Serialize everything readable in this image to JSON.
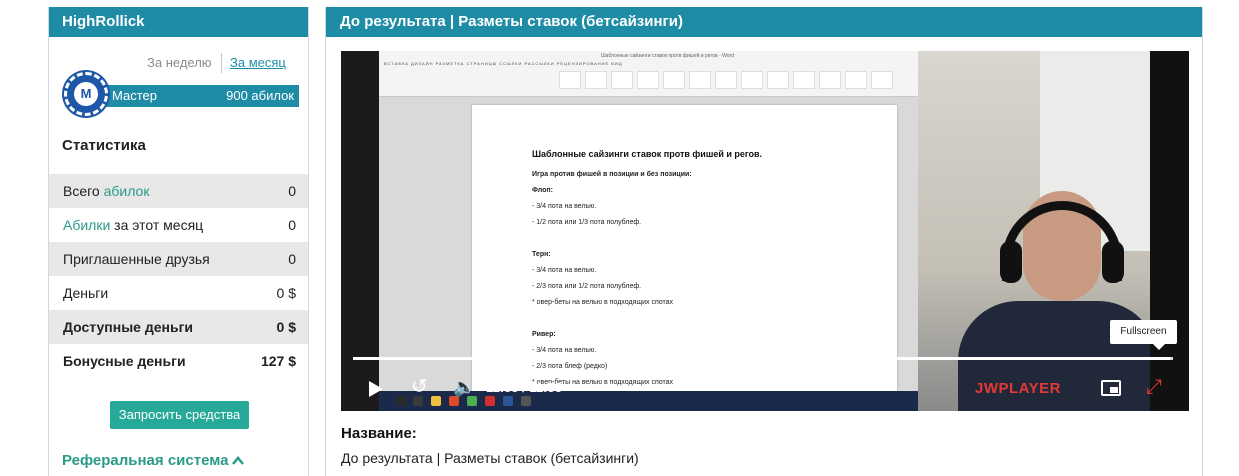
{
  "left_panel": {
    "header": "HighRollick",
    "tab_week": "За неделю",
    "tab_month": "За месяц",
    "level_badge_letter": "М",
    "level_name": "Мастер",
    "level_points": "900 абилок",
    "stats_title": "Статистика",
    "stats": [
      {
        "label_pre": "Всего ",
        "label_link": "абилок",
        "label_post": "",
        "value": "0"
      },
      {
        "label_pre": "",
        "label_link": "Абилки",
        "label_post": " за этот месяц",
        "value": "0"
      },
      {
        "label_pre": "Приглашенные друзья",
        "label_link": "",
        "label_post": "",
        "value": "0"
      },
      {
        "label_pre": "Деньги",
        "label_link": "",
        "label_post": "",
        "value": "0 $"
      },
      {
        "label_pre": "Доступные деньги",
        "label_link": "",
        "label_post": "",
        "value": "0 $"
      },
      {
        "label_pre": "Бонусные деньги",
        "label_link": "",
        "label_post": "",
        "value": "127 $"
      }
    ],
    "request_button": "Запросить средства",
    "referral": "Реферальная система",
    "referral_chevron": "chevron-up-icon"
  },
  "right_panel": {
    "header": "До результата | Разметы ставок (бетсайзинги)",
    "video": {
      "doc_window_title": "Шаблонные сайзинги ставок протв фишей и регов - Word",
      "doc_ribbon_tabs": "ВСТАВКА   ДИЗАЙН   РАЗМЕТКА СТРАНИЦЫ   ССЫЛКИ   РАССЫЛКИ   РЕЦЕНЗИРОВАНИЕ   ВИД",
      "doc_title": "Шаблонные сайзинги ставок протв фишей и регов.",
      "doc_lines": [
        {
          "text": "Игра против фишей в позиции и без позиции:",
          "bold": true
        },
        {
          "text": "Флоп:",
          "bold": true
        },
        {
          "text": "- 3/4 пота на велью.",
          "bold": false
        },
        {
          "text": "- 1/2 пота или 1/3 пота полублеф.",
          "bold": false
        },
        {
          "text": "Терн:",
          "bold": true
        },
        {
          "text": "- 3/4 пота на велью.",
          "bold": false
        },
        {
          "text": "- 2/3 пота или 1/2 пота полублеф.",
          "bold": false
        },
        {
          "text": "* овер-беты на велью в подходящих спотах",
          "bold": false
        },
        {
          "text": "Ривер:",
          "bold": true
        },
        {
          "text": "- 3/4 пота на велью.",
          "bold": false
        },
        {
          "text": "- 2/3 пота блеф (редко)",
          "bold": false
        },
        {
          "text": "* овер-беты на велью в подходящих спотах",
          "bold": false
        }
      ],
      "progress": 0.996,
      "rewind_seconds": "10",
      "current_time": "11:55",
      "time_separator": "/",
      "duration": "11:58",
      "player_logo_prefix": "JW",
      "player_logo_rest": "PLAYER",
      "tooltip": "Fullscreen",
      "icons": [
        "play-icon",
        "rewind-10-icon",
        "volume-icon",
        "pip-icon",
        "fullscreen-icon"
      ]
    },
    "name_label": "Название:",
    "name_value": "До результата | Разметы ставок (бетсайзинги)"
  },
  "colors": {
    "header_bg": "#1f8ca6",
    "accent_teal": "#2a9a8a",
    "button_bg": "#27a99a",
    "row_shade": "#e8e8e8",
    "player_red": "#e53935"
  }
}
